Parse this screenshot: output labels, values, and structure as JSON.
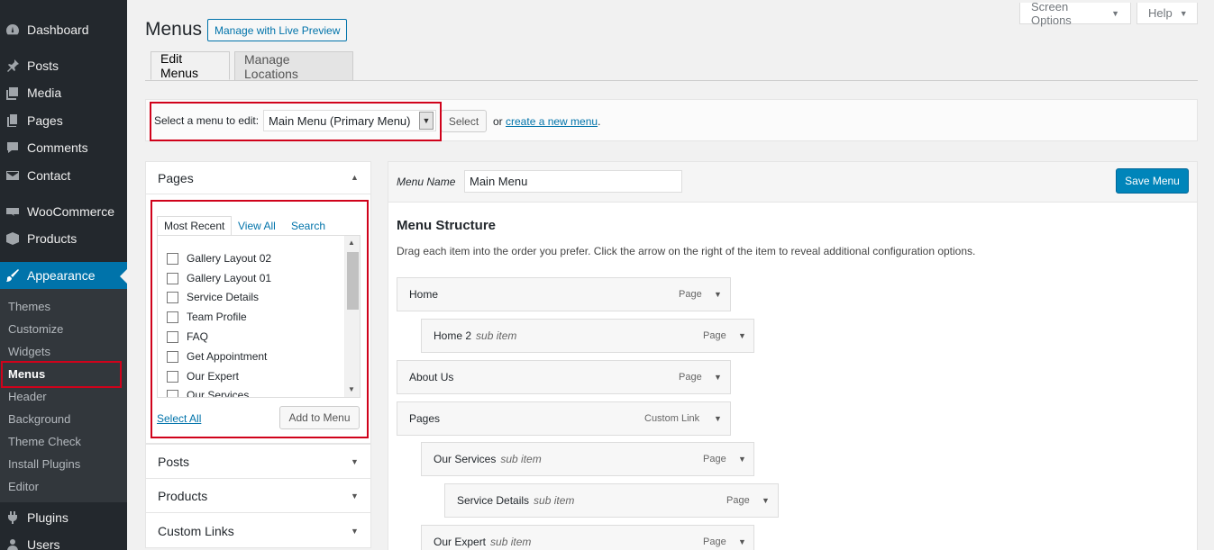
{
  "sidebar": {
    "items": [
      {
        "label": "Dashboard",
        "icon": "dashboard-icon"
      },
      {
        "label": "Posts",
        "icon": "pin-icon"
      },
      {
        "label": "Media",
        "icon": "media-icon"
      },
      {
        "label": "Pages",
        "icon": "pages-icon"
      },
      {
        "label": "Comments",
        "icon": "comment-icon"
      },
      {
        "label": "Contact",
        "icon": "mail-icon"
      },
      {
        "label": "WooCommerce",
        "icon": "woo-icon"
      },
      {
        "label": "Products",
        "icon": "box-icon"
      },
      {
        "label": "Appearance",
        "icon": "brush-icon"
      },
      {
        "label": "Plugins",
        "icon": "plugin-icon"
      },
      {
        "label": "Users",
        "icon": "user-icon"
      }
    ],
    "submenu": [
      "Themes",
      "Customize",
      "Widgets",
      "Menus",
      "Header",
      "Background",
      "Theme Check",
      "Install Plugins",
      "Editor"
    ]
  },
  "top": {
    "screen_options": "Screen Options",
    "help": "Help"
  },
  "header": {
    "title": "Menus",
    "live_preview": "Manage with Live Preview"
  },
  "tabs": [
    "Edit Menus",
    "Manage Locations"
  ],
  "select_bar": {
    "label": "Select a menu to edit:",
    "selected": "Main Menu (Primary Menu)",
    "select_button": "Select",
    "or_text": "or",
    "create_link": "create a new menu",
    "period": "."
  },
  "left_panel": {
    "pages_title": "Pages",
    "inner_tabs": [
      "Most Recent",
      "View All",
      "Search"
    ],
    "pages_list": [
      "Gallery Layout 02",
      "Gallery Layout 01",
      "Service Details",
      "Team Profile",
      "FAQ",
      "Get Appointment",
      "Our Expert",
      "Our Services"
    ],
    "select_all": "Select All",
    "add_to_menu": "Add to Menu",
    "sections": [
      "Posts",
      "Products",
      "Custom Links"
    ]
  },
  "right_panel": {
    "menu_name_label": "Menu Name",
    "menu_name_value": "Main Menu",
    "save_button": "Save Menu",
    "structure_title": "Menu Structure",
    "structure_desc": "Drag each item into the order you prefer. Click the arrow on the right of the item to reveal additional configuration options.",
    "items": [
      {
        "title": "Home",
        "sub": "",
        "type": "Page",
        "depth": 0
      },
      {
        "title": "Home 2",
        "sub": "sub item",
        "type": "Page",
        "depth": 1
      },
      {
        "title": "About Us",
        "sub": "",
        "type": "Page",
        "depth": 0
      },
      {
        "title": "Pages",
        "sub": "",
        "type": "Custom Link",
        "depth": 0
      },
      {
        "title": "Our Services",
        "sub": "sub item",
        "type": "Page",
        "depth": 1
      },
      {
        "title": "Service Details",
        "sub": "sub item",
        "type": "Page",
        "depth": 2
      },
      {
        "title": "Our Expert",
        "sub": "sub item",
        "type": "Page",
        "depth": 1
      }
    ]
  },
  "colors": {
    "accent": "#0073aa",
    "highlight": "#d0021b",
    "sidebar": "#23282d"
  }
}
